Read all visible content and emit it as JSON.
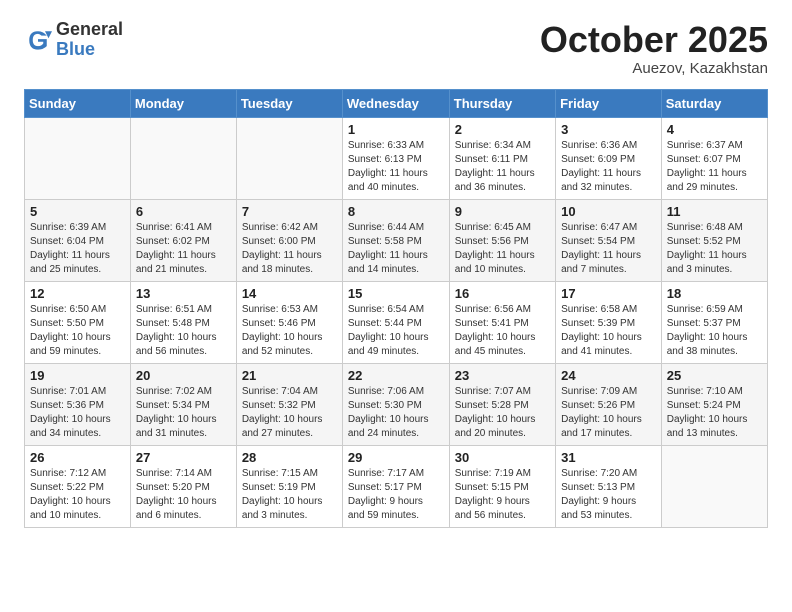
{
  "header": {
    "logo_general": "General",
    "logo_blue": "Blue",
    "month": "October 2025",
    "location": "Auezov, Kazakhstan"
  },
  "weekdays": [
    "Sunday",
    "Monday",
    "Tuesday",
    "Wednesday",
    "Thursday",
    "Friday",
    "Saturday"
  ],
  "weeks": [
    [
      {
        "day": "",
        "detail": ""
      },
      {
        "day": "",
        "detail": ""
      },
      {
        "day": "",
        "detail": ""
      },
      {
        "day": "1",
        "detail": "Sunrise: 6:33 AM\nSunset: 6:13 PM\nDaylight: 11 hours\nand 40 minutes."
      },
      {
        "day": "2",
        "detail": "Sunrise: 6:34 AM\nSunset: 6:11 PM\nDaylight: 11 hours\nand 36 minutes."
      },
      {
        "day": "3",
        "detail": "Sunrise: 6:36 AM\nSunset: 6:09 PM\nDaylight: 11 hours\nand 32 minutes."
      },
      {
        "day": "4",
        "detail": "Sunrise: 6:37 AM\nSunset: 6:07 PM\nDaylight: 11 hours\nand 29 minutes."
      }
    ],
    [
      {
        "day": "5",
        "detail": "Sunrise: 6:39 AM\nSunset: 6:04 PM\nDaylight: 11 hours\nand 25 minutes."
      },
      {
        "day": "6",
        "detail": "Sunrise: 6:41 AM\nSunset: 6:02 PM\nDaylight: 11 hours\nand 21 minutes."
      },
      {
        "day": "7",
        "detail": "Sunrise: 6:42 AM\nSunset: 6:00 PM\nDaylight: 11 hours\nand 18 minutes."
      },
      {
        "day": "8",
        "detail": "Sunrise: 6:44 AM\nSunset: 5:58 PM\nDaylight: 11 hours\nand 14 minutes."
      },
      {
        "day": "9",
        "detail": "Sunrise: 6:45 AM\nSunset: 5:56 PM\nDaylight: 11 hours\nand 10 minutes."
      },
      {
        "day": "10",
        "detail": "Sunrise: 6:47 AM\nSunset: 5:54 PM\nDaylight: 11 hours\nand 7 minutes."
      },
      {
        "day": "11",
        "detail": "Sunrise: 6:48 AM\nSunset: 5:52 PM\nDaylight: 11 hours\nand 3 minutes."
      }
    ],
    [
      {
        "day": "12",
        "detail": "Sunrise: 6:50 AM\nSunset: 5:50 PM\nDaylight: 10 hours\nand 59 minutes."
      },
      {
        "day": "13",
        "detail": "Sunrise: 6:51 AM\nSunset: 5:48 PM\nDaylight: 10 hours\nand 56 minutes."
      },
      {
        "day": "14",
        "detail": "Sunrise: 6:53 AM\nSunset: 5:46 PM\nDaylight: 10 hours\nand 52 minutes."
      },
      {
        "day": "15",
        "detail": "Sunrise: 6:54 AM\nSunset: 5:44 PM\nDaylight: 10 hours\nand 49 minutes."
      },
      {
        "day": "16",
        "detail": "Sunrise: 6:56 AM\nSunset: 5:41 PM\nDaylight: 10 hours\nand 45 minutes."
      },
      {
        "day": "17",
        "detail": "Sunrise: 6:58 AM\nSunset: 5:39 PM\nDaylight: 10 hours\nand 41 minutes."
      },
      {
        "day": "18",
        "detail": "Sunrise: 6:59 AM\nSunset: 5:37 PM\nDaylight: 10 hours\nand 38 minutes."
      }
    ],
    [
      {
        "day": "19",
        "detail": "Sunrise: 7:01 AM\nSunset: 5:36 PM\nDaylight: 10 hours\nand 34 minutes."
      },
      {
        "day": "20",
        "detail": "Sunrise: 7:02 AM\nSunset: 5:34 PM\nDaylight: 10 hours\nand 31 minutes."
      },
      {
        "day": "21",
        "detail": "Sunrise: 7:04 AM\nSunset: 5:32 PM\nDaylight: 10 hours\nand 27 minutes."
      },
      {
        "day": "22",
        "detail": "Sunrise: 7:06 AM\nSunset: 5:30 PM\nDaylight: 10 hours\nand 24 minutes."
      },
      {
        "day": "23",
        "detail": "Sunrise: 7:07 AM\nSunset: 5:28 PM\nDaylight: 10 hours\nand 20 minutes."
      },
      {
        "day": "24",
        "detail": "Sunrise: 7:09 AM\nSunset: 5:26 PM\nDaylight: 10 hours\nand 17 minutes."
      },
      {
        "day": "25",
        "detail": "Sunrise: 7:10 AM\nSunset: 5:24 PM\nDaylight: 10 hours\nand 13 minutes."
      }
    ],
    [
      {
        "day": "26",
        "detail": "Sunrise: 7:12 AM\nSunset: 5:22 PM\nDaylight: 10 hours\nand 10 minutes."
      },
      {
        "day": "27",
        "detail": "Sunrise: 7:14 AM\nSunset: 5:20 PM\nDaylight: 10 hours\nand 6 minutes."
      },
      {
        "day": "28",
        "detail": "Sunrise: 7:15 AM\nSunset: 5:19 PM\nDaylight: 10 hours\nand 3 minutes."
      },
      {
        "day": "29",
        "detail": "Sunrise: 7:17 AM\nSunset: 5:17 PM\nDaylight: 9 hours\nand 59 minutes."
      },
      {
        "day": "30",
        "detail": "Sunrise: 7:19 AM\nSunset: 5:15 PM\nDaylight: 9 hours\nand 56 minutes."
      },
      {
        "day": "31",
        "detail": "Sunrise: 7:20 AM\nSunset: 5:13 PM\nDaylight: 9 hours\nand 53 minutes."
      },
      {
        "day": "",
        "detail": ""
      }
    ]
  ]
}
